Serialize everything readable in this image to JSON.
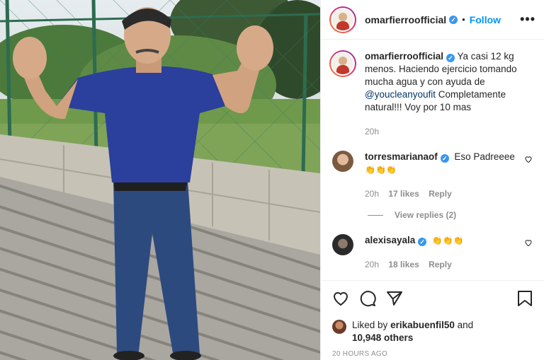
{
  "post": {
    "author": "omarfierroofficial",
    "follow_label": "Follow",
    "dot": "•",
    "more": "•••",
    "verified_mark": "✓"
  },
  "caption": {
    "author": "omarfierroofficial",
    "text_part1": "Ya casi 12 kg menos. Haciendo ejercicio tomando mucha agua y con ayuda de",
    "mention": "@youcleanyoufit",
    "text_part2": "Completamente natural!!! Voy por 10 mas",
    "time": "20h"
  },
  "comments": [
    {
      "user": "torresmarianaof",
      "text": "Eso Padreeee",
      "emoji": "👏👏👏",
      "time": "20h",
      "likes": "17 likes",
      "reply": "Reply",
      "view_replies": "View replies (2)"
    },
    {
      "user": "alexisayala",
      "emoji": "👏👏👏",
      "time": "20h",
      "likes": "18 likes",
      "reply": "Reply"
    }
  ],
  "likes": {
    "prefix": "Liked by",
    "user": "erikabuenfil50",
    "and": "and",
    "others": "10,948 others"
  },
  "timestamp": "20 HOURS AGO",
  "icons": {
    "like": "heart-icon",
    "comment": "comment-icon",
    "share": "paper-plane-icon",
    "save": "bookmark-icon",
    "comment_like": "heart-icon"
  },
  "colors": {
    "link": "#0095f6",
    "verified": "#3897f0",
    "mention": "#00376b",
    "muted": "#8e8e8e"
  }
}
